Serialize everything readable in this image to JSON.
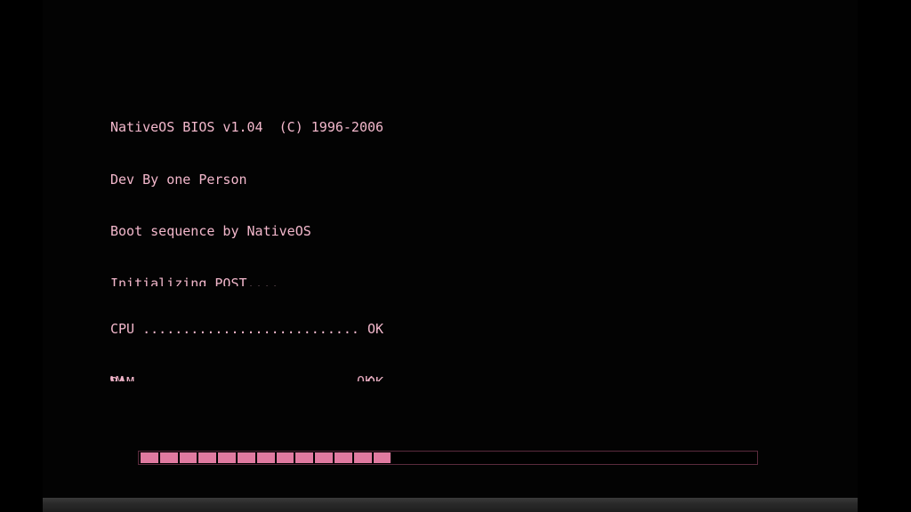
{
  "bios": {
    "lines": [
      "NativeOS BIOS v1.04  (C) 1996-2006",
      "Dev By one Person",
      "Boot sequence by NativeOS",
      "Initializing POST....",
      "CPU ........................... OK",
      "RAM ........................... OK"
    ]
  },
  "progress": {
    "fraction": 0.41,
    "blocks_filled": 13,
    "color": "#e07aa0"
  },
  "colors": {
    "background": "#000000",
    "text": "#f3b8cc",
    "progress_border": "#5a2a3c"
  }
}
